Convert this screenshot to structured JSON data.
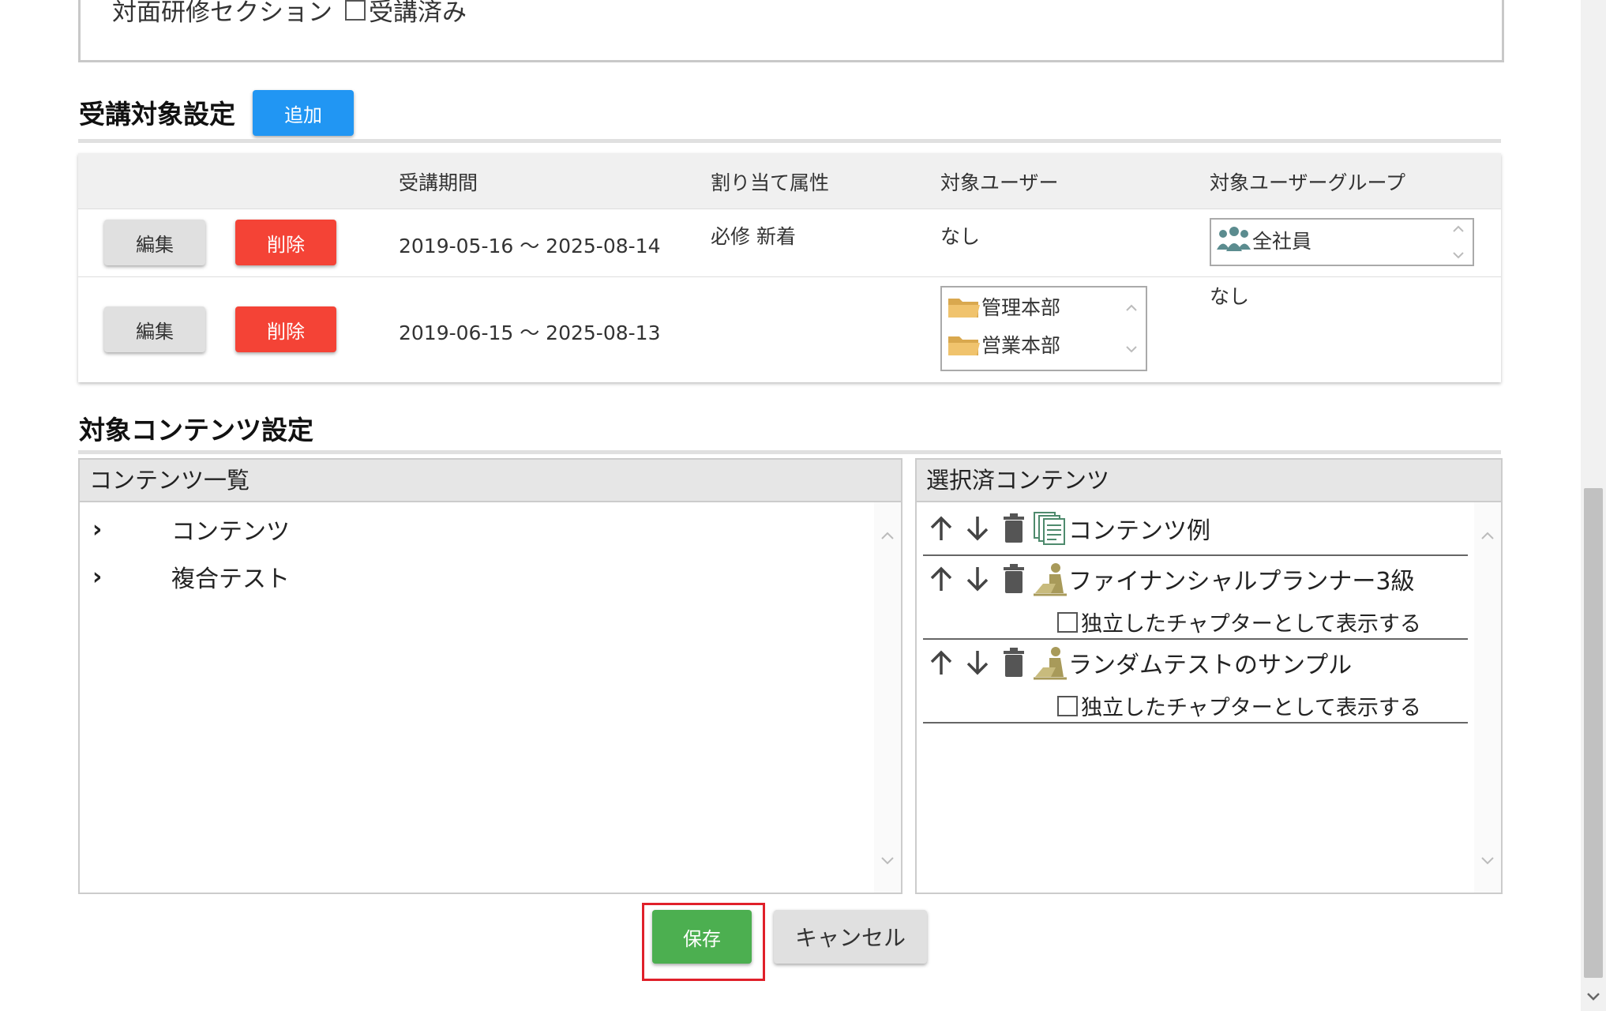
{
  "top_section": {
    "label": "対面研修セクション",
    "checkbox_label": "受講済み"
  },
  "target_settings": {
    "title": "受講対象設定",
    "add_button": "追加",
    "columns": [
      "受講期間",
      "割り当て属性",
      "対象ユーザー",
      "対象ユーザーグループ"
    ],
    "rows": [
      {
        "edit": "編集",
        "delete": "削除",
        "period": "2019-05-16 〜 2025-08-14",
        "attributes": "必修 新着",
        "users": "なし",
        "groups": [
          "全社員"
        ]
      },
      {
        "edit": "編集",
        "delete": "削除",
        "period": "2019-06-15 〜 2025-08-13",
        "attributes": "",
        "users": [
          "管理本部",
          "営業本部"
        ],
        "groups": "なし"
      }
    ]
  },
  "content_settings": {
    "title": "対象コンテンツ設定",
    "list_pane": {
      "title": "コンテンツ一覧",
      "items": [
        "コンテンツ",
        "複合テスト"
      ]
    },
    "selected_pane": {
      "title": "選択済コンテンツ",
      "items": [
        {
          "name": "コンテンツ例",
          "icon": "content-stack-icon"
        },
        {
          "name": "ファイナンシャルプランナー3級",
          "icon": "test-person-icon",
          "option": "独立したチャプターとして表示する"
        },
        {
          "name": "ランダムテストのサンプル",
          "icon": "test-person-icon",
          "option": "独立したチャプターとして表示する"
        }
      ]
    }
  },
  "footer": {
    "save": "保存",
    "cancel": "キャンセル"
  },
  "colors": {
    "primary": "#2196f3",
    "danger": "#f44336",
    "success": "#4caf50",
    "highlight": "#e0202a"
  }
}
